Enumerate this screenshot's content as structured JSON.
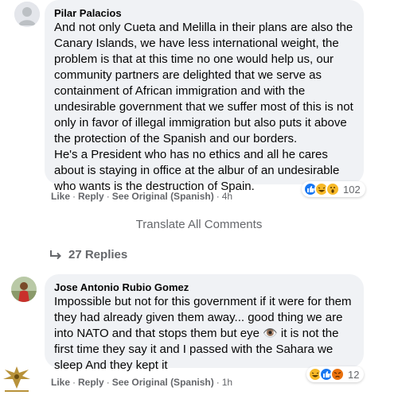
{
  "comments": [
    {
      "author": "Pilar Palacios",
      "paragraphs": [
        "And not only Cueta and Melilla in their plans are also the Canary Islands, we have less international weight, the problem is that at this time no one would help us, our community partners are delighted that we serve as containment of African immigration and with the undesirable government that we suffer most of this is not only in favor of illegal immigration but also puts it above the protection of the Spanish and our borders.",
        "He's a President who has no ethics and all he cares about is staying in office at the albur of an undesirable who wants is the destruction of Spain."
      ],
      "actions": {
        "like": "Like",
        "reply": "Reply",
        "see_original": "See Original (Spanish)",
        "time": "4h"
      },
      "reaction_count": "102",
      "reaction_icons": [
        "like-icon",
        "haha-icon",
        "wow-icon"
      ]
    },
    {
      "author": "Jose Antonio Rubio Gomez",
      "paragraphs": [
        "Impossible but not for this government if it were for them they had already given them away... good thing we are into NATO and that stops them but eye 👁️ it is not the first time they say it and I passed with the Sahara we sleep And they kept it"
      ],
      "actions": {
        "like": "Like",
        "reply": "Reply",
        "see_original": "See Original (Spanish)",
        "time": "1h"
      },
      "reaction_count": "12",
      "reaction_icons": [
        "haha-icon",
        "like-icon",
        "angry-icon"
      ]
    }
  ],
  "translate_all": "Translate All Comments",
  "replies_label": "27 Replies",
  "colors": {
    "bubble": "#f0f2f5",
    "secondary_text": "#65676b",
    "like_blue": "#1877f2",
    "haha_yellow": "#f7b928",
    "angry_orange": "#e9710f"
  }
}
